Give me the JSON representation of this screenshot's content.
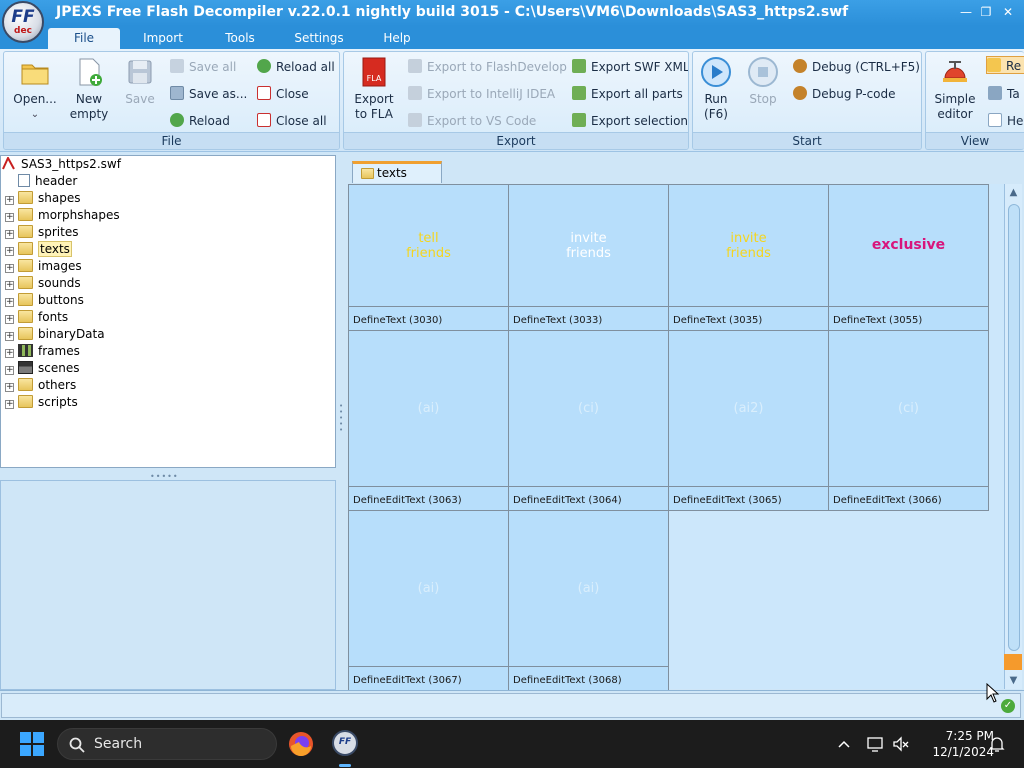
{
  "window": {
    "title": "JPEXS Free Flash Decompiler v.22.0.1 nightly build 3015 - C:\\Users\\VM6\\Downloads\\SAS3_https2.swf",
    "logo_text": "FF",
    "logo_sub": "dec"
  },
  "menu": [
    "File",
    "Import",
    "Tools",
    "Settings",
    "Help"
  ],
  "ribbon": {
    "file": {
      "label": "File",
      "open": "Open...",
      "new_empty": "New empty",
      "save": "Save",
      "save_all": "Save all",
      "save_as": "Save as...",
      "reload": "Reload",
      "reload_all": "Reload all",
      "close": "Close",
      "close_all": "Close all"
    },
    "export": {
      "label": "Export",
      "to_fla": "Export to FLA",
      "fla_icon_text": "FLA",
      "to_flashdevelop": "Export to FlashDevelop",
      "to_intellij": "Export to IntelliJ IDEA",
      "to_vscode": "Export to VS Code",
      "swf_xml": "Export SWF XML",
      "all_parts": "Export all parts",
      "selection": "Export selection"
    },
    "start": {
      "label": "Start",
      "run": "Run",
      "run_key": "(F6)",
      "stop": "Stop",
      "debug": "Debug (CTRL+F5)",
      "debug_pcode": "Debug P-code"
    },
    "view": {
      "label": "View",
      "simple_editor": "Simple editor",
      "partial_1": "Re",
      "partial_2": "Ta",
      "partial_3": "He"
    }
  },
  "tree": {
    "root": "SAS3_https2.swf",
    "items": [
      {
        "label": "header",
        "expandable": false,
        "icon": "header-icon"
      },
      {
        "label": "shapes",
        "expandable": true,
        "icon": "folder-icon"
      },
      {
        "label": "morphshapes",
        "expandable": true,
        "icon": "folder-icon"
      },
      {
        "label": "sprites",
        "expandable": true,
        "icon": "folder-icon"
      },
      {
        "label": "texts",
        "expandable": true,
        "icon": "folder-icon",
        "selected": true
      },
      {
        "label": "images",
        "expandable": true,
        "icon": "folder-icon"
      },
      {
        "label": "sounds",
        "expandable": true,
        "icon": "folder-icon"
      },
      {
        "label": "buttons",
        "expandable": true,
        "icon": "folder-icon"
      },
      {
        "label": "fonts",
        "expandable": true,
        "icon": "folder-icon"
      },
      {
        "label": "binaryData",
        "expandable": true,
        "icon": "folder-icon"
      },
      {
        "label": "frames",
        "expandable": true,
        "icon": "film-icon"
      },
      {
        "label": "scenes",
        "expandable": true,
        "icon": "clapper-icon"
      },
      {
        "label": "others",
        "expandable": true,
        "icon": "folder-icon"
      },
      {
        "label": "scripts",
        "expandable": true,
        "icon": "folder-icon"
      }
    ]
  },
  "content_tab": "texts",
  "cells": [
    {
      "caption": "DefineText (3030)",
      "lines": [
        "tell",
        "friends"
      ],
      "color": "#f5d51e"
    },
    {
      "caption": "DefineText (3033)",
      "lines": [
        "invite",
        "friends"
      ],
      "color": "#ffffff"
    },
    {
      "caption": "DefineText (3035)",
      "lines": [
        "invite",
        "friends"
      ],
      "color": "#f5d51e"
    },
    {
      "caption": "DefineText (3055)",
      "lines": [
        "exclusive"
      ],
      "color": "#d8157c"
    },
    {
      "caption": "DefineEditText (3063)",
      "lines": [
        "(ai)"
      ],
      "color": "#d9eefc"
    },
    {
      "caption": "DefineEditText (3064)",
      "lines": [
        "(ci)"
      ],
      "color": "#d9eefc"
    },
    {
      "caption": "DefineEditText (3065)",
      "lines": [
        "(ai2)"
      ],
      "color": "#d9eefc"
    },
    {
      "caption": "DefineEditText (3066)",
      "lines": [
        "(ci)"
      ],
      "color": "#d9eefc"
    },
    {
      "caption": "DefineEditText (3067)",
      "lines": [
        "(ai)"
      ],
      "color": "#d9eefc"
    },
    {
      "caption": "DefineEditText (3068)",
      "lines": [
        "(ai)"
      ],
      "color": "#d9eefc"
    }
  ],
  "taskbar": {
    "search_placeholder": "Search",
    "time": "7:25 PM",
    "date": "12/1/2024"
  },
  "colors": {
    "titlebar": "#2b8fd9",
    "ribbon": "#d7ebfa",
    "preview_bg": "#b7defb",
    "selection": "#fff3b8",
    "taskbar": "#1c1c1c"
  }
}
